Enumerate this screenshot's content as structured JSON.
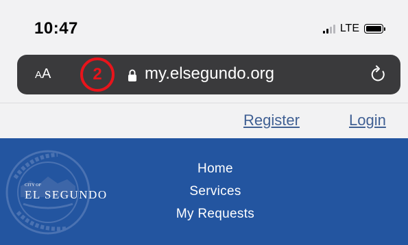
{
  "status_bar": {
    "time": "10:47",
    "network": "LTE"
  },
  "browser": {
    "text_size_small": "A",
    "text_size_large": "A",
    "url": "my.elsegundo.org",
    "step_marker": "2"
  },
  "nav_links": {
    "register": "Register",
    "login": "Login"
  },
  "header": {
    "logo_small": "CITY OF",
    "logo_main": "EL SEGUNDO",
    "menu": [
      {
        "label": "Home"
      },
      {
        "label": "Services"
      },
      {
        "label": "My Requests"
      }
    ]
  },
  "colors": {
    "header_bg": "#2355a0",
    "link": "#3f5f93",
    "url_bar_bg": "#3a3a3c",
    "annotation": "#e8141b"
  },
  "icons": {
    "signal": "cellular-signal-icon",
    "battery": "battery-icon",
    "lock": "lock-icon",
    "reload": "reload-icon"
  }
}
